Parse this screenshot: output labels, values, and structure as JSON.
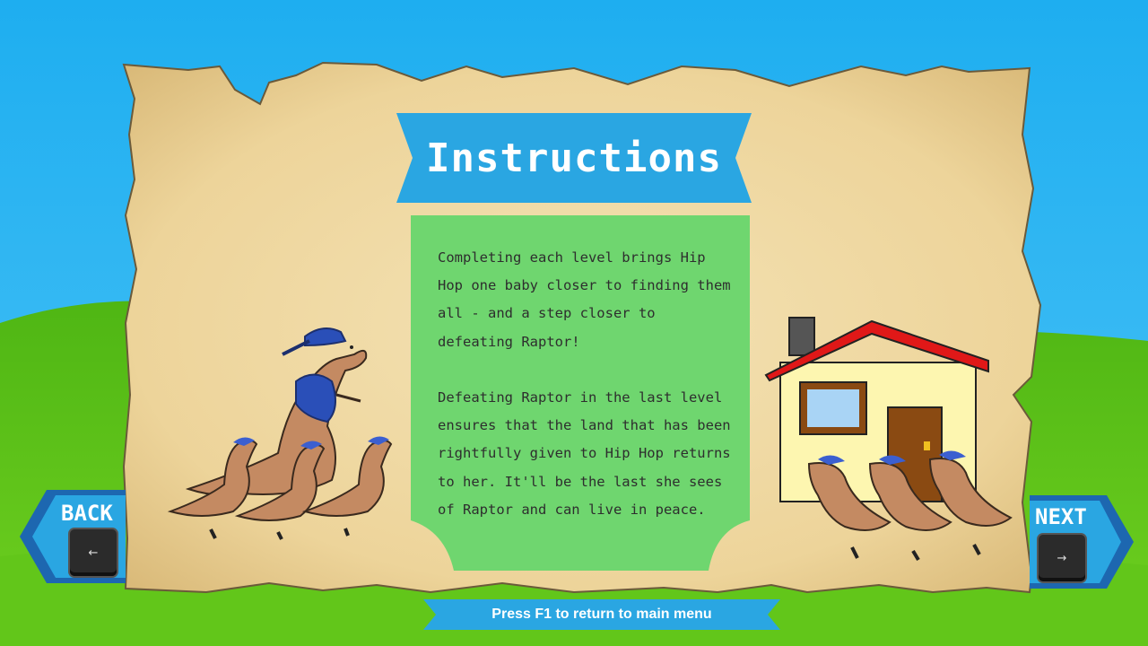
{
  "title": "Instructions",
  "paragraphs": [
    "Completing each level brings Hip Hop one baby closer to finding them all - and a step closer to defeating Raptor!",
    "Defeating Raptor in the last level ensures that the land that has been rightfully given to Hip Hop returns to her. It'll be the last she sees of Raptor and can live in peace."
  ],
  "back": {
    "label": "BACK",
    "key": "←"
  },
  "next": {
    "label": "NEXT",
    "key": "→"
  },
  "footer": "Press F1 to return to main menu",
  "colors": {
    "sky": "#23b4f2",
    "grass": "#5cc21a",
    "parchment": "#f0d9a3",
    "banner_blue": "#2aa6e2",
    "panel_green": "#6fd66f",
    "roof_red": "#e01818",
    "house_wall": "#fdf6b0",
    "door_brown": "#8a4a12"
  },
  "icons": {
    "kangaroo_mom": "kangaroo-mother-icon",
    "joey": "joey-icon",
    "house": "house-icon"
  }
}
